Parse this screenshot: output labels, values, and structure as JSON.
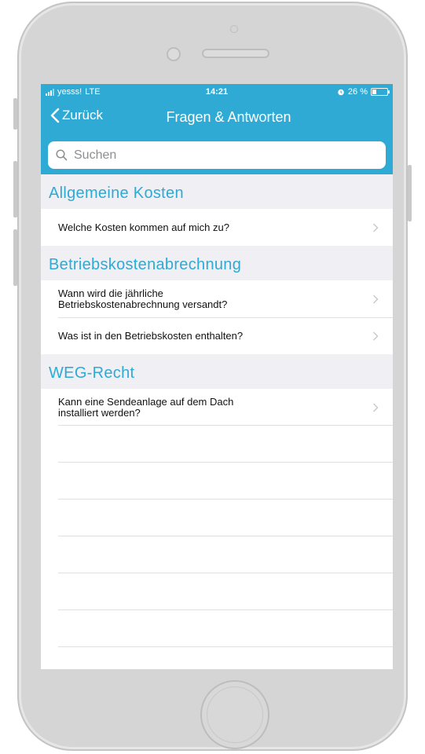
{
  "status_bar": {
    "carrier": "yesss!",
    "network": "LTE",
    "time": "14:21",
    "alarm_icon": "alarm-icon",
    "battery": "26 %"
  },
  "nav": {
    "back_label": "Zurück",
    "title": "Fragen & Antworten"
  },
  "search": {
    "placeholder": "Suchen"
  },
  "sections": [
    {
      "title": "Allgemeine Kosten",
      "items": [
        "Welche Kosten kommen auf mich zu?"
      ]
    },
    {
      "title": "Betriebskostenabrechnung",
      "items": [
        "Wann wird die jährliche Betriebskostenabrechnung versandt?",
        "Was ist in den Betriebskosten enthalten?"
      ]
    },
    {
      "title": "WEG-Recht",
      "items": [
        "Kann eine Sendeanlage auf dem Dach installiert werden?"
      ]
    }
  ],
  "colors": {
    "accent": "#2eaad5",
    "background": "#efeff4"
  }
}
